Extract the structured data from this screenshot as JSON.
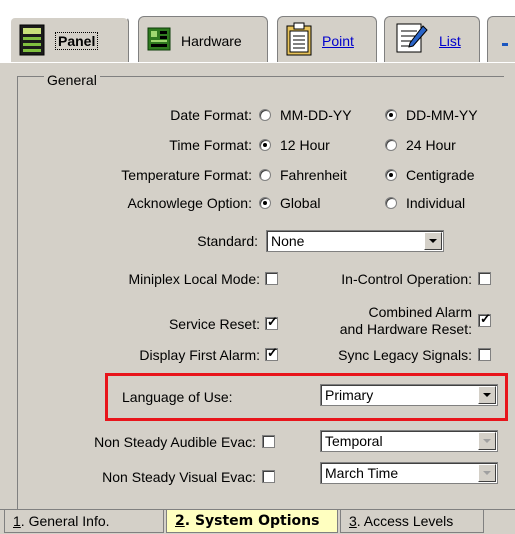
{
  "toolbar": {
    "buttons": [
      {
        "label": "Panel",
        "icon": "panel-icon"
      },
      {
        "label": "Hardware",
        "icon": "hardware-icon"
      },
      {
        "label": "Point",
        "icon": "point-icon"
      },
      {
        "label": "List",
        "icon": "list-icon"
      }
    ]
  },
  "group": {
    "title": "General"
  },
  "fields": {
    "date_format": {
      "label": "Date Format:",
      "opt1": "MM-DD-YY",
      "opt2": "DD-MM-YY",
      "selected": "DD-MM-YY"
    },
    "time_format": {
      "label": "Time Format:",
      "opt1": "12 Hour",
      "opt2": "24 Hour",
      "selected": "12 Hour"
    },
    "temperature_format": {
      "label": "Temperature Format:",
      "opt1": "Fahrenheit",
      "opt2": "Centigrade",
      "selected": "Centigrade"
    },
    "acknowledge_option": {
      "label": "Acknowlege Option:",
      "opt1": "Global",
      "opt2": "Individual",
      "selected": "Global"
    },
    "standard": {
      "label": "Standard:",
      "value": "None"
    },
    "miniplex_local_mode": {
      "label": "Miniplex Local Mode:",
      "checked": false
    },
    "in_control_operation": {
      "label": "In-Control Operation:",
      "checked": false
    },
    "service_reset": {
      "label": "Service Reset:",
      "checked": true
    },
    "combined_alarm": {
      "label_line1": "Combined Alarm",
      "label_line2": "and Hardware Reset:",
      "checked": true
    },
    "display_first_alarm": {
      "label": "Display First Alarm:",
      "checked": true
    },
    "sync_legacy_signals": {
      "label": "Sync Legacy Signals:",
      "checked": false
    },
    "language_of_use": {
      "label": "Language of Use:",
      "value": "Primary"
    },
    "non_steady_audible_evac": {
      "label": "Non Steady Audible Evac:",
      "checked": false,
      "value": "Temporal"
    },
    "non_steady_visual_evac": {
      "label": "Non Steady Visual Evac:",
      "checked": false,
      "value": "March Time"
    }
  },
  "tabs": [
    {
      "num": "1",
      "label": ". General Info."
    },
    {
      "num": "2",
      "label": ". System Options"
    },
    {
      "num": "3",
      "label": ". Access Levels"
    }
  ],
  "colors": {
    "highlight": "#e8141b",
    "active_tab": "#ffffc0",
    "panel_bg": "#d4d0c8"
  }
}
